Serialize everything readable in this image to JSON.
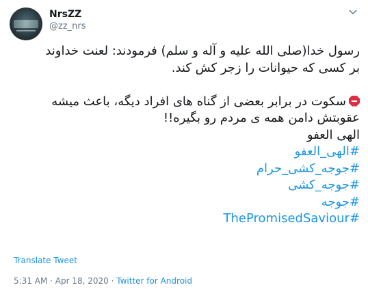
{
  "author": {
    "display_name": "NrsZZ",
    "handle": "@zz_nrs"
  },
  "tweet": {
    "line1": "رسول خدا(صلی الله علیه و آله و سلم) فرمودند: لعنت خداوند",
    "line2": "بر کسی که حیوانات را زجر کش کند.",
    "line3": "سکوت در برابر بعضی از گناه های افراد دیگه، باعث میشه",
    "line4": "عقوبتش دامن همه ی مردم رو بگیره!!",
    "line5": "الهی العفو",
    "hashtags": [
      "#الهی_العفو",
      "#جوجه_کشی_حرام",
      "#جوجه_کشی",
      "#جوجه",
      "#ThePromisedSaviour"
    ],
    "stop_icon": "octagonal-sign-emoji"
  },
  "translate_label": "Translate Tweet",
  "meta": {
    "time": "5:31 AM",
    "separator1": " · ",
    "date": "Apr 18, 2020",
    "separator2": " · ",
    "source": "Twitter for Android"
  },
  "colors": {
    "link": "#1b95e0",
    "secondary": "#657786",
    "text": "#14171a"
  }
}
